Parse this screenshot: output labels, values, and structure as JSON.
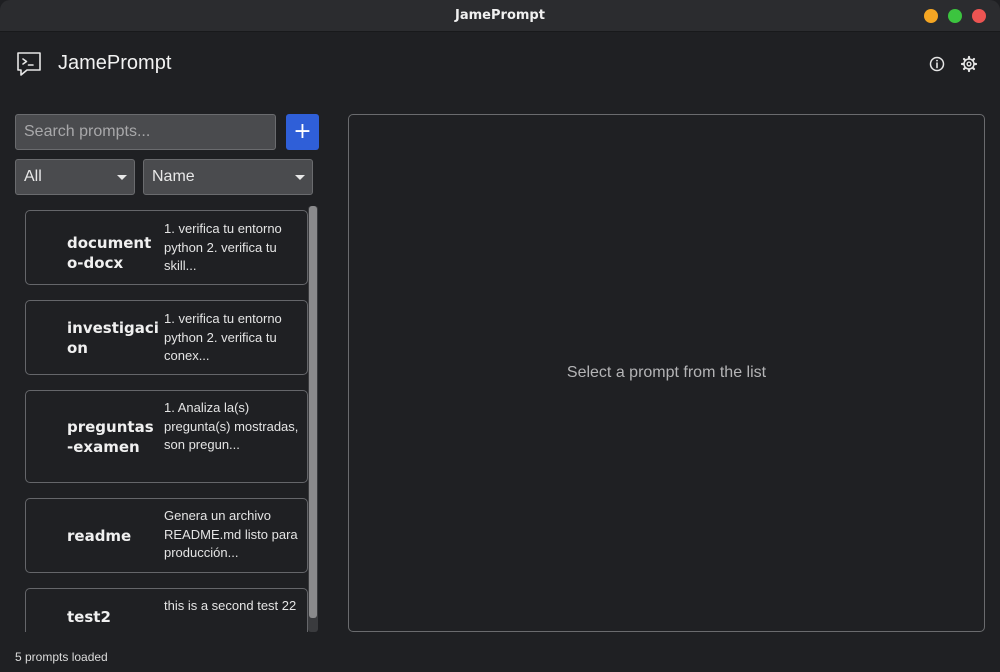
{
  "window": {
    "title": "JamePrompt"
  },
  "header": {
    "app_name": "JamePrompt",
    "logo_icon": "terminal-chat-icon",
    "info_icon": "info-icon",
    "settings_icon": "gear-icon"
  },
  "search": {
    "placeholder": "Search prompts...",
    "value": "",
    "add_label": "+"
  },
  "filters": {
    "category_selected": "All",
    "sort_selected": "Name"
  },
  "prompts": [
    {
      "name": "documento-docx",
      "description": "1. verifica tu entorno python 2. verifica tu skill..."
    },
    {
      "name": "investigacion",
      "description": "1. verifica tu entorno python 2. verifica tu conex..."
    },
    {
      "name": "preguntas-examen",
      "description": "1. Analiza la(s) pregunta(s) mostradas, son pregun..."
    },
    {
      "name": "readme",
      "description": "Genera un archivo README.md listo para producción..."
    },
    {
      "name": "test2",
      "description": "this is a second test 22"
    }
  ],
  "detail": {
    "empty_text": "Select a prompt from the list"
  },
  "status": {
    "text": "5 prompts loaded"
  },
  "colors": {
    "accent": "#2f5fd8",
    "background": "#1f2023"
  }
}
